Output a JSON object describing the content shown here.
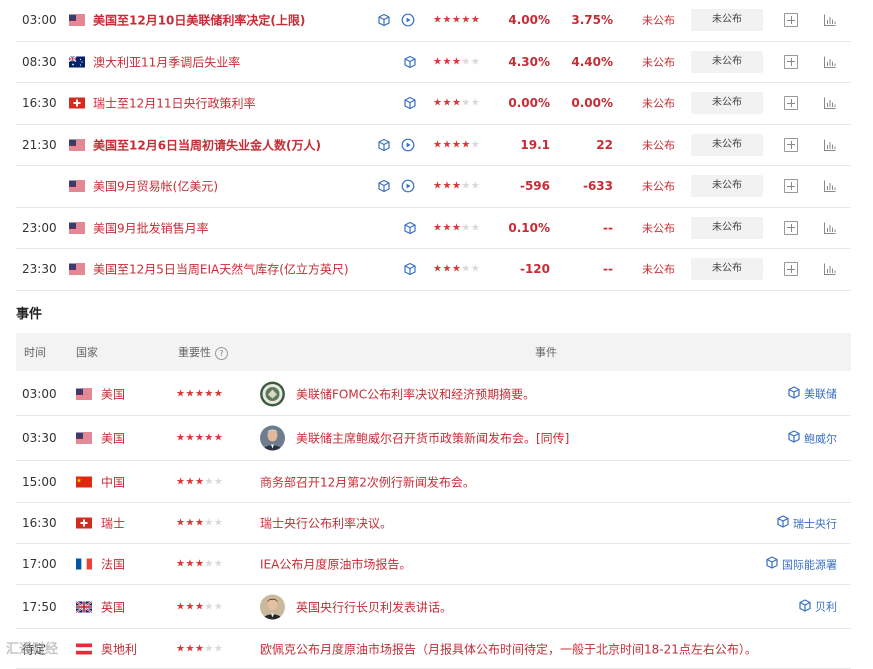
{
  "data_rows": [
    {
      "time": "03:00",
      "country": "us",
      "name": "美国至12月10日美联储利率决定(上限)",
      "bold": true,
      "has_play": true,
      "stars": 5,
      "previous": "4.00%",
      "forecast": "3.75%",
      "actual": "未公布",
      "status": "未公布"
    },
    {
      "time": "08:30",
      "country": "au",
      "name": "澳大利亚11月季调后失业率",
      "bold": false,
      "has_play": false,
      "stars": 3,
      "previous": "4.30%",
      "forecast": "4.40%",
      "actual": "未公布",
      "status": "未公布"
    },
    {
      "time": "16:30",
      "country": "ch",
      "name": "瑞士至12月11日央行政策利率",
      "bold": false,
      "has_play": false,
      "stars": 3,
      "previous": "0.00%",
      "forecast": "0.00%",
      "actual": "未公布",
      "status": "未公布"
    },
    {
      "time": "21:30",
      "country": "us",
      "name": "美国至12月6日当周初请失业金人数(万人)",
      "bold": true,
      "has_play": true,
      "stars": 4,
      "previous": "19.1",
      "forecast": "22",
      "actual": "未公布",
      "status": "未公布"
    },
    {
      "time": "",
      "country": "us",
      "name": "美国9月贸易帐(亿美元)",
      "bold": false,
      "has_play": true,
      "stars": 3,
      "previous": "-596",
      "forecast": "-633",
      "actual": "未公布",
      "status": "未公布"
    },
    {
      "time": "23:00",
      "country": "us",
      "name": "美国9月批发销售月率",
      "bold": false,
      "has_play": false,
      "stars": 3,
      "previous": "0.10%",
      "forecast": "--",
      "actual": "未公布",
      "status": "未公布"
    },
    {
      "time": "23:30",
      "country": "us",
      "name": "美国至12月5日当周EIA天然气库存(亿立方英尺)",
      "bold": false,
      "has_play": false,
      "stars": 3,
      "previous": "-120",
      "forecast": "--",
      "actual": "未公布",
      "status": "未公布"
    }
  ],
  "events_section": {
    "title": "事件",
    "headers": {
      "time": "时间",
      "country": "国家",
      "importance": "重要性",
      "event": "事件"
    },
    "help_glyph": "?"
  },
  "event_rows": [
    {
      "time": "03:00",
      "country": "us",
      "country_name": "美国",
      "stars": 5,
      "avatar": "seal",
      "text": "美联储FOMC公布利率决议和经济预期摘要。",
      "tag": "美联储"
    },
    {
      "time": "03:30",
      "country": "us",
      "country_name": "美国",
      "stars": 5,
      "avatar": "person",
      "text": "美联储主席鲍威尔召开货币政策新闻发布会。[同传]",
      "tag": "鲍威尔"
    },
    {
      "time": "15:00",
      "country": "cn",
      "country_name": "中国",
      "stars": 3,
      "avatar": "",
      "text": "商务部召开12月第2次例行新闻发布会。",
      "tag": ""
    },
    {
      "time": "16:30",
      "country": "ch",
      "country_name": "瑞士",
      "stars": 3,
      "avatar": "",
      "text": "瑞士央行公布利率决议。",
      "tag": "瑞士央行"
    },
    {
      "time": "17:00",
      "country": "fr",
      "country_name": "法国",
      "stars": 3,
      "avatar": "",
      "text": "IEA公布月度原油市场报告。",
      "tag": "国际能源署"
    },
    {
      "time": "17:50",
      "country": "gb",
      "country_name": "英国",
      "stars": 3,
      "avatar": "person2",
      "text": "英国央行行长贝利发表讲话。",
      "tag": "贝利"
    },
    {
      "time": "待定",
      "country": "at",
      "country_name": "奥地利",
      "stars": 3,
      "avatar": "",
      "text": "欧佩克公布月度原油市场报告（月报具体公布时间待定，一般于北京时间18-21点左右公布）。",
      "tag": ""
    }
  ],
  "watermark": "汇通财经",
  "colors": {
    "accent": "#c62d36",
    "star": "#d83a3a",
    "link": "#3a6fc2"
  }
}
